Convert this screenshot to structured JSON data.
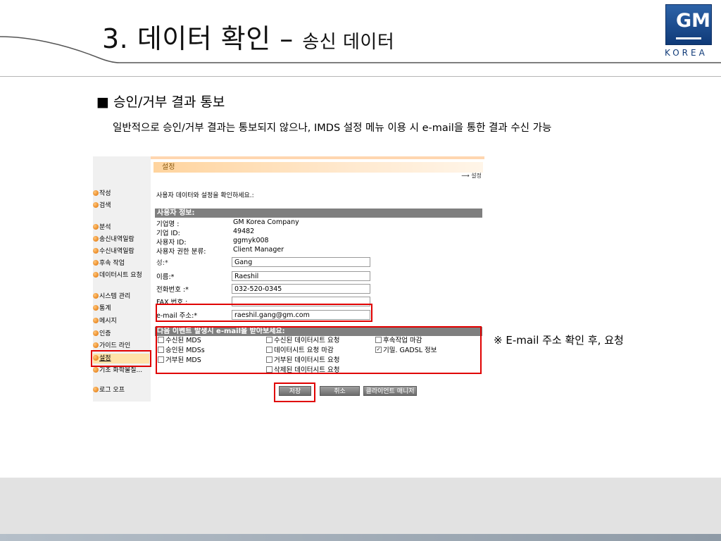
{
  "slide": {
    "title": "3. 데이터 확인 –",
    "subtitle": "송신 데이터",
    "logo": {
      "brand": "GM",
      "region": "KOREA"
    },
    "section_heading": "■ 승인/거부 결과 통보",
    "section_desc": "일반적으로 승인/거부 결과는 통보되지 않으나, IMDS 설정 메뉴 이용 시 e-mail을 통한 결과 수신 가능",
    "note": "※ E-mail 주소 확인 후, 요청"
  },
  "imds": {
    "page_title": "설정",
    "breadcrumb": "설정",
    "intro": "사용자 데이터와 설정을 확인하세요.:",
    "sidebar": [
      "작성",
      "검색",
      "분석",
      "송신내역일람",
      "수신내역일람",
      "후속 작업",
      "데이터시트 요청",
      "시스템 관리",
      "통계",
      "메시지",
      "인증",
      "가이드 라인",
      "설정",
      "기초 화학물질...",
      "로그 오프"
    ],
    "user_info": {
      "header": "사용자 정보:",
      "company_label": "기업명 :",
      "company_value": "GM Korea Company",
      "company_id_label": "기업 ID:",
      "company_id_value": "49482",
      "user_id_label": "사용자 ID:",
      "user_id_value": "ggmyk008",
      "role_label": "사용자 권한 분류:",
      "role_value": "Client Manager",
      "last_name_label": "성:*",
      "last_name_value": "Gang",
      "first_name_label": "이름:*",
      "first_name_value": "Raeshil",
      "phone_label": "전화번호 :*",
      "phone_value": "032-520-0345",
      "fax_label": "FAX 번호 :",
      "fax_value": "",
      "email_label": "e-mail 주소:*",
      "email_value": "raeshil.gang@gm.com"
    },
    "notify": {
      "header": "다음 이벤트 발생시 e-mail을 받아보세요:",
      "col1": [
        "수신된 MDS",
        "승인된 MDSs",
        "거부된 MDS"
      ],
      "col2": [
        "수신된 데이터시트 요청",
        "데이터시트 요청 마감",
        "거부된 데이터시트 요청",
        "삭제된 데이터시트 요청"
      ],
      "col3": [
        "후속작업 마감",
        "기밀. GADSL 정보"
      ],
      "col3_checked": [
        false,
        true
      ]
    },
    "buttons": {
      "save": "저장",
      "cancel": "취소",
      "client_manager": "클라이언트 매니저"
    }
  },
  "colors": {
    "highlight": "#e00000",
    "accent_orange": "#ff8a1e",
    "gm_blue": "#1a4c8f",
    "bar_gray": "#7f7f7f"
  }
}
